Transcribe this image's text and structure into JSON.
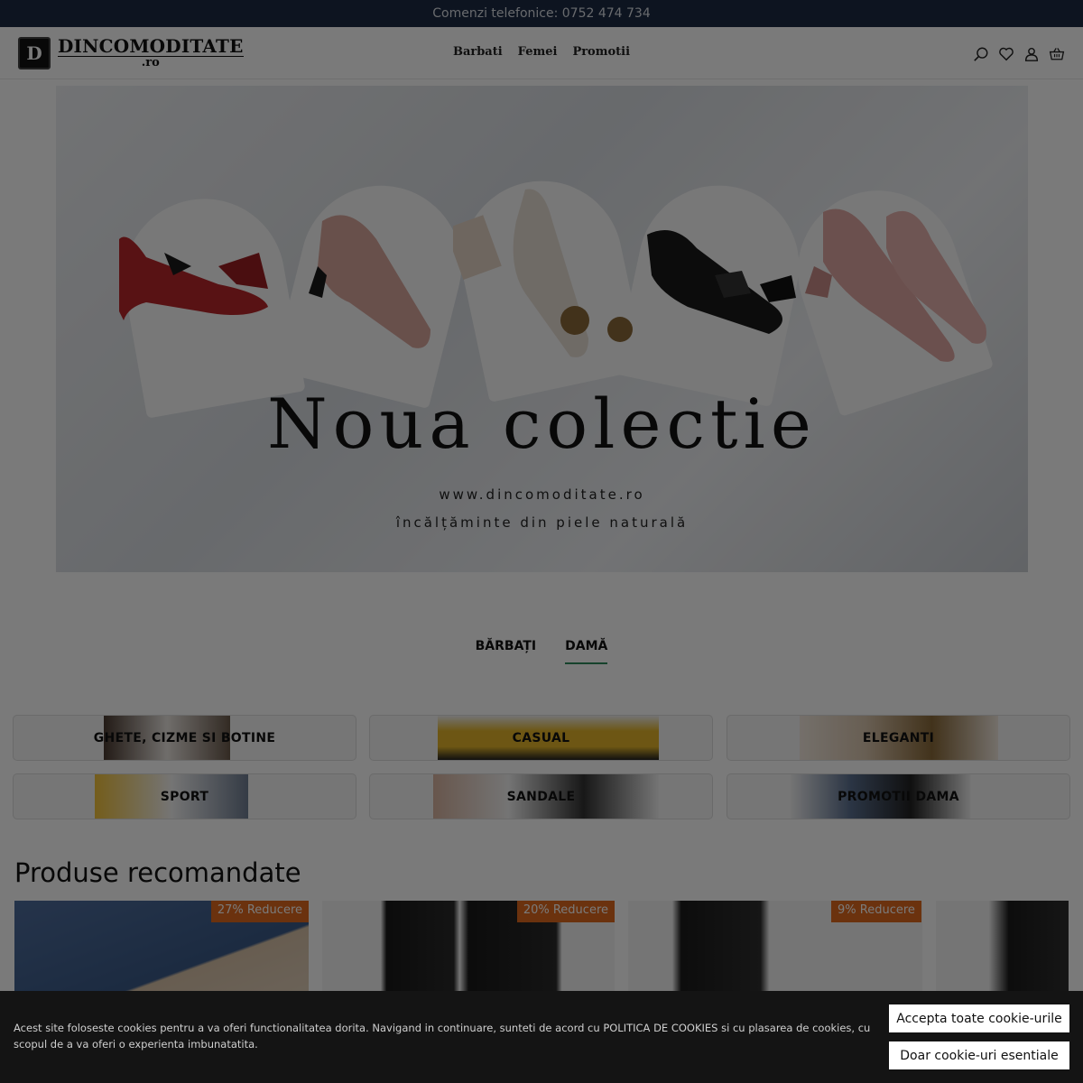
{
  "topbar": {
    "text": "Comenzi telefonice: 0752 474 734"
  },
  "header": {
    "logo_mark": "D",
    "logo_name": "DINCOMODITATE",
    "logo_tld": ".ro",
    "nav": [
      "Barbati",
      "Femei",
      "Promotii"
    ],
    "icons": [
      "search-icon",
      "heart-icon",
      "user-icon",
      "basket-icon"
    ]
  },
  "banner": {
    "title": "Noua colectie",
    "url": "www.dincomoditate.ro",
    "tagline": "încălțăminte din piele naturală",
    "shoe_colors": [
      "#b8262a",
      "#d9a79e",
      "#e8dfd6",
      "#1a1a1a",
      "#e0a8a4"
    ]
  },
  "tabs": [
    {
      "label": "BĂRBAȚI",
      "active": false
    },
    {
      "label": "DAMĂ",
      "active": true
    }
  ],
  "categories": [
    {
      "label": "GHETE, CIZME SI BOTINE"
    },
    {
      "label": "CASUAL"
    },
    {
      "label": "ELEGANTI"
    },
    {
      "label": "SPORT"
    },
    {
      "label": "SANDALE"
    },
    {
      "label": "PROMOTII DAMA"
    }
  ],
  "recommended": {
    "title": "Produse recomandate",
    "products": [
      {
        "badge": "27% Reducere"
      },
      {
        "badge": "20% Reducere"
      },
      {
        "badge": "9% Reducere"
      }
    ]
  },
  "cookie": {
    "text": "Acest site foloseste cookies pentru a va oferi functionalitatea dorita. Navigand in continuare, sunteti de acord cu POLITICA DE COOKIES si cu plasarea de cookies, cu scopul de a va oferi o experienta imbunatatita.",
    "accept_all": "Accepta toate cookie-urile",
    "essential_only": "Doar cookie-uri esentiale"
  },
  "colors": {
    "topbar": "#1c2b44",
    "tab_underline": "#2f8a5c",
    "badge": "#e06a1f",
    "cookie_bg": "#141414"
  }
}
